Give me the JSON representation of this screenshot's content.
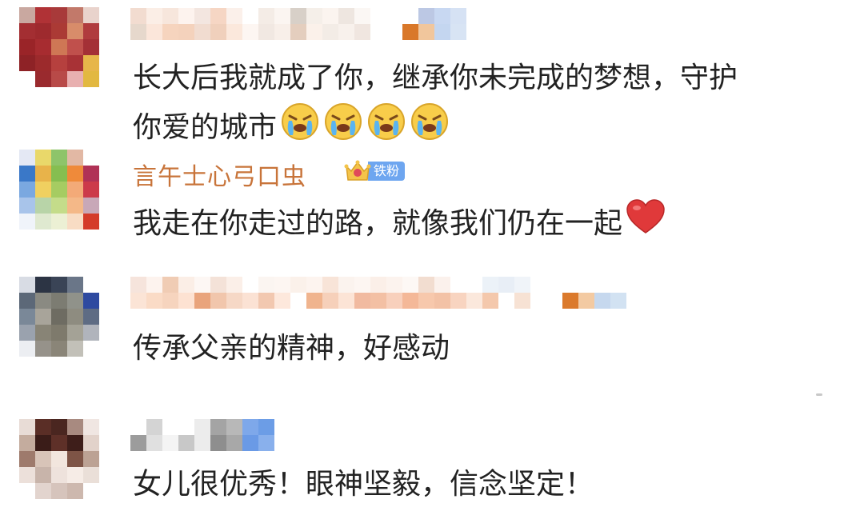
{
  "comments": [
    {
      "text_line1": "长大后我就成了你，继承你未完成的梦想，守护",
      "text_line2": "你爱的城市",
      "emojis": [
        "crying-face-icon",
        "crying-face-icon",
        "crying-face-icon",
        "crying-face-icon"
      ]
    },
    {
      "username": "言午士心弓口虫",
      "badge_label": "铁粉",
      "text": "我走在你走过的路，就像我们仍在一起",
      "emoji": "red-heart-icon"
    },
    {
      "text": "传承父亲的精神，好感动"
    },
    {
      "text": "女儿很优秀！眼神坚毅，信念坚定！"
    }
  ],
  "colors": {
    "username": "#c8743a",
    "badge": "#6ea6f0",
    "text": "#222222"
  }
}
